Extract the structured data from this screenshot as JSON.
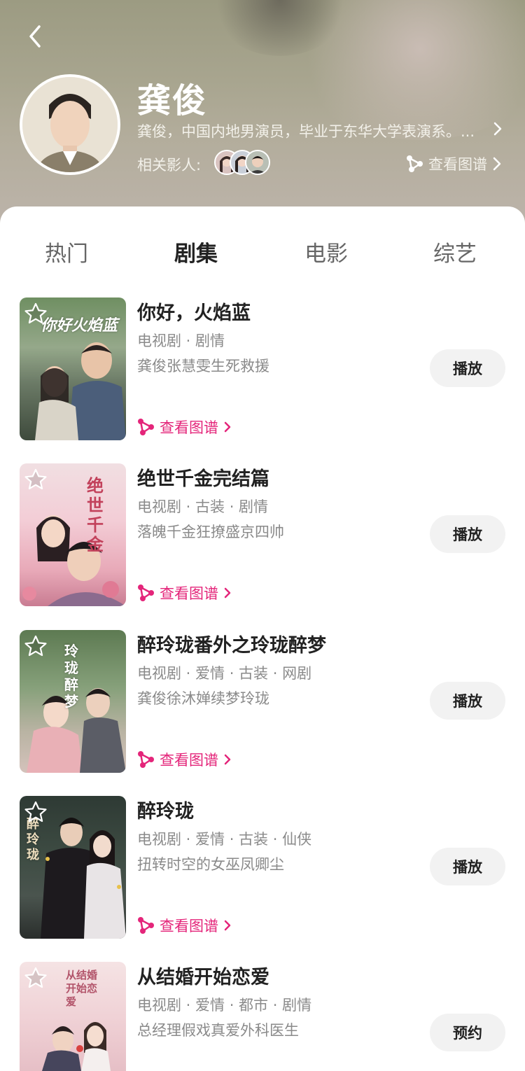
{
  "header": {
    "name": "龚俊",
    "bio": "龚俊，中国内地男演员，毕业于东华大学表演系。...",
    "related_label": "相关影人:",
    "graph_label": "查看图谱"
  },
  "tabs": [
    {
      "label": "热门",
      "active": false
    },
    {
      "label": "剧集",
      "active": true
    },
    {
      "label": "电影",
      "active": false
    },
    {
      "label": "综艺",
      "active": false
    }
  ],
  "items": [
    {
      "title": "你好，火焰蓝",
      "meta": "电视剧 · 剧情",
      "desc": "龚俊张慧雯生死救援",
      "map_label": "查看图谱",
      "action": "播放",
      "poster_text": "你好火焰蓝"
    },
    {
      "title": "绝世千金完结篇",
      "meta": "电视剧 · 古装 · 剧情",
      "desc": "落魄千金狂撩盛京四帅",
      "map_label": "查看图谱",
      "action": "播放",
      "poster_text": "绝世千金"
    },
    {
      "title": "醉玲珑番外之玲珑醉梦",
      "meta": "电视剧 · 爱情 · 古装 · 网剧",
      "desc": "龚俊徐沐婵续梦玲珑",
      "map_label": "查看图谱",
      "action": "播放",
      "poster_text": "玲珑醉梦"
    },
    {
      "title": "醉玲珑",
      "meta": "电视剧 · 爱情 · 古装 · 仙侠",
      "desc": "扭转时空的女巫凤卿尘",
      "map_label": "查看图谱",
      "action": "播放",
      "poster_text": "醉玲珑"
    },
    {
      "title": "从结婚开始恋爱",
      "meta": "电视剧 · 爱情 · 都市 · 剧情",
      "desc": "总经理假戏真爱外科医生",
      "map_label": "",
      "action": "预约",
      "poster_text": "从结婚开始恋爱"
    }
  ],
  "colors": {
    "accent": "#e4257a"
  }
}
